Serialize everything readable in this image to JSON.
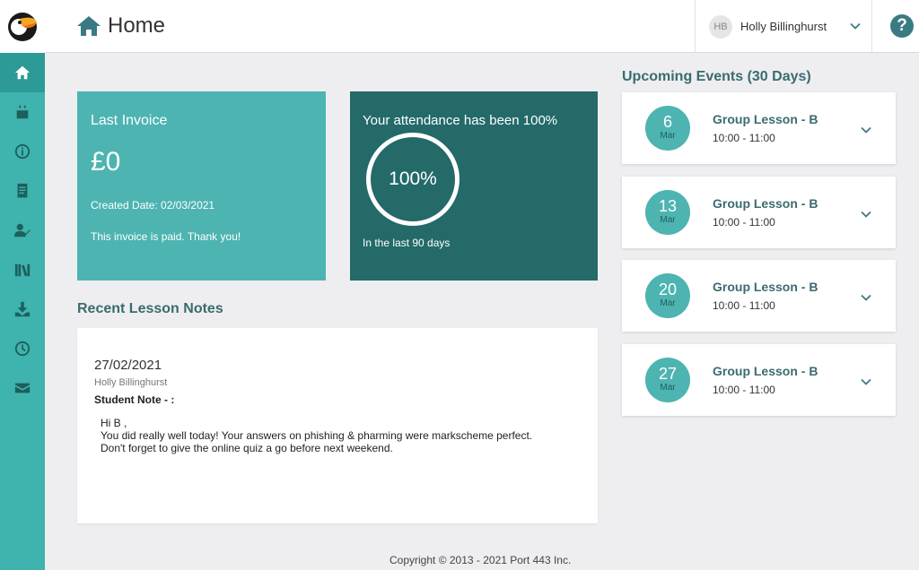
{
  "header": {
    "page_title": "Home",
    "user_initials": "HB",
    "user_name": "Holly Billinghurst",
    "help_label": "?"
  },
  "sidebar": {
    "items": [
      {
        "icon": "home-icon",
        "active": true
      },
      {
        "icon": "calendar-icon",
        "active": false
      },
      {
        "icon": "info-icon",
        "active": false
      },
      {
        "icon": "receipt-icon",
        "active": false
      },
      {
        "icon": "user-check-icon",
        "active": false
      },
      {
        "icon": "library-icon",
        "active": false
      },
      {
        "icon": "download-icon",
        "active": false
      },
      {
        "icon": "clock-icon",
        "active": false
      },
      {
        "icon": "mail-icon",
        "active": false
      }
    ]
  },
  "invoice": {
    "title": "Last Invoice",
    "amount": "£0",
    "created": "Created Date: 02/03/2021",
    "status": "This invoice is paid. Thank you!"
  },
  "attendance": {
    "title": "Your attendance has been 100%",
    "percent_label": "100%",
    "subtitle": "In the last 90 days"
  },
  "lesson_notes": {
    "section_title": "Recent Lesson Notes",
    "date": "27/02/2021",
    "author": "Holly Billinghurst",
    "label": "Student Note - :",
    "greeting": "Hi B ,",
    "line1": "You did really well today! Your answers on phishing & pharming were markscheme perfect.",
    "line2": "Don't forget to give the online quiz a go before next weekend."
  },
  "events": {
    "section_title": "Upcoming Events (30 Days)",
    "items": [
      {
        "day": "6",
        "month": "Mar",
        "name": "Group Lesson - B",
        "time": "10:00 - 11:00"
      },
      {
        "day": "13",
        "month": "Mar",
        "name": "Group Lesson - B",
        "time": "10:00 - 11:00"
      },
      {
        "day": "20",
        "month": "Mar",
        "name": "Group Lesson - B",
        "time": "10:00 - 11:00"
      },
      {
        "day": "27",
        "month": "Mar",
        "name": "Group Lesson - B",
        "time": "10:00 - 11:00"
      }
    ]
  },
  "footer": {
    "copyright": "Copyright © 2013 - 2021 Port 443 Inc."
  },
  "colors": {
    "sidebar": "#3fb3ad",
    "invoice_card": "#4db4b1",
    "attendance_card": "#236a69",
    "accent_text": "#3a6b70"
  }
}
